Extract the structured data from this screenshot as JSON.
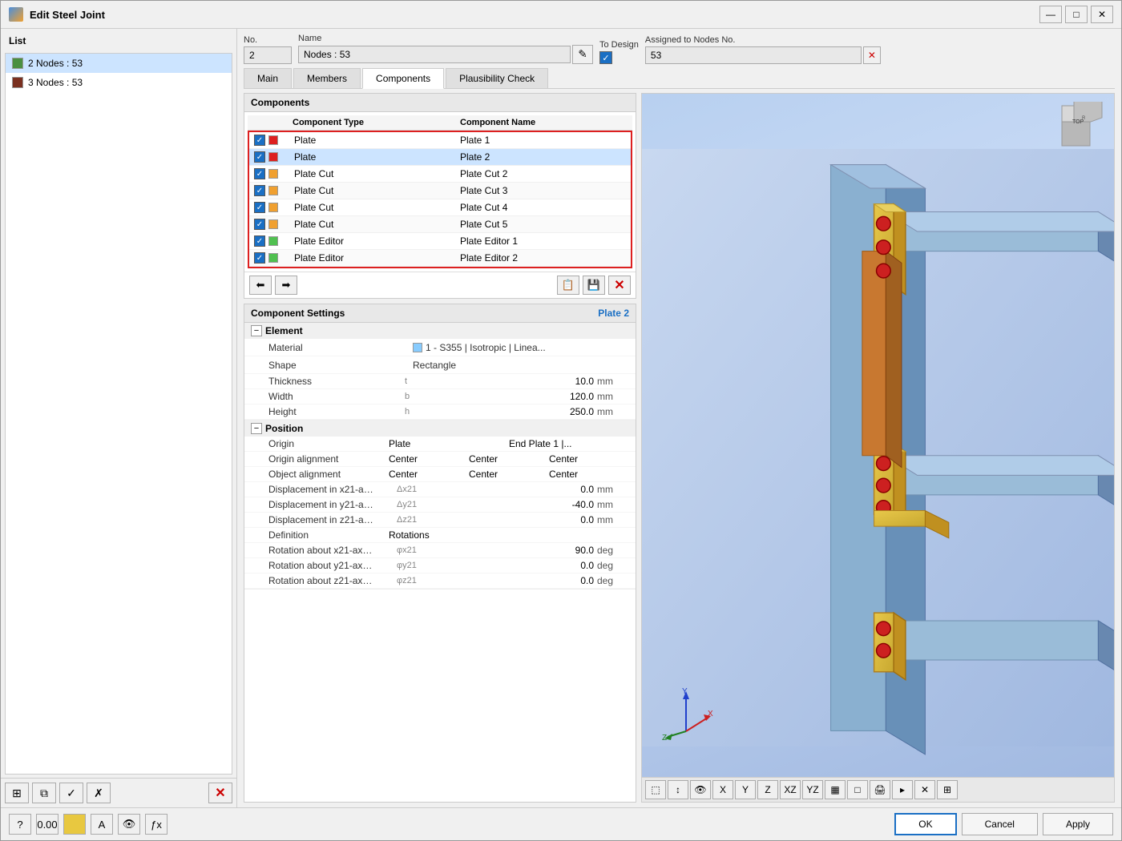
{
  "window": {
    "title": "Edit Steel Joint",
    "minimize_label": "—",
    "maximize_label": "□",
    "close_label": "✕"
  },
  "list": {
    "header": "List",
    "items": [
      {
        "id": 1,
        "label": "2 Nodes : 53",
        "color": "#4a8f40",
        "selected": true
      },
      {
        "id": 2,
        "label": "3 Nodes : 53",
        "color": "#7a3020",
        "selected": false
      }
    ]
  },
  "header": {
    "no_label": "No.",
    "no_value": "2",
    "name_label": "Name",
    "name_value": "Nodes : 53",
    "to_design_label": "To Design",
    "assigned_label": "Assigned to Nodes No.",
    "assigned_value": "53"
  },
  "tabs": [
    {
      "id": "main",
      "label": "Main",
      "active": false
    },
    {
      "id": "members",
      "label": "Members",
      "active": false
    },
    {
      "id": "components",
      "label": "Components",
      "active": true
    },
    {
      "id": "plausibility",
      "label": "Plausibility Check",
      "active": false
    }
  ],
  "components": {
    "section_title": "Components",
    "col_type": "Component Type",
    "col_name": "Component Name",
    "items": [
      {
        "checked": true,
        "color": "red",
        "type": "Plate",
        "name": "Plate 1"
      },
      {
        "checked": true,
        "color": "red",
        "type": "Plate",
        "name": "Plate 2",
        "selected": true
      },
      {
        "checked": true,
        "color": "orange",
        "type": "Plate Cut",
        "name": "Plate Cut 2"
      },
      {
        "checked": true,
        "color": "orange",
        "type": "Plate Cut",
        "name": "Plate Cut 3"
      },
      {
        "checked": true,
        "color": "orange",
        "type": "Plate Cut",
        "name": "Plate Cut 4"
      },
      {
        "checked": true,
        "color": "orange",
        "type": "Plate Cut",
        "name": "Plate Cut 5"
      },
      {
        "checked": true,
        "color": "green",
        "type": "Plate Editor",
        "name": "Plate Editor 1"
      },
      {
        "checked": true,
        "color": "green",
        "type": "Plate Editor",
        "name": "Plate Editor 2"
      }
    ]
  },
  "component_settings": {
    "title": "Component Settings",
    "active_name": "Plate 2",
    "element_group": "Element",
    "properties": {
      "material_label": "Material",
      "material_value": "1 - S355 | Isotropic | Linea...",
      "shape_label": "Shape",
      "shape_value": "Rectangle",
      "thickness_label": "Thickness",
      "thickness_sym": "t",
      "thickness_value": "10.0",
      "thickness_unit": "mm",
      "width_label": "Width",
      "width_sym": "b",
      "width_value": "120.0",
      "width_unit": "mm",
      "height_label": "Height",
      "height_sym": "h",
      "height_value": "250.0",
      "height_unit": "mm"
    },
    "position_group": "Position",
    "position_props": {
      "origin_label": "Origin",
      "origin_val1": "Plate",
      "origin_val2": "End Plate 1 |...",
      "origin_align_label": "Origin alignment",
      "origin_align_val1": "Center",
      "origin_align_val2": "Center",
      "origin_align_val3": "Center",
      "object_align_label": "Object alignment",
      "object_align_val1": "Center",
      "object_align_val2": "Center",
      "object_align_val3": "Center",
      "disp_x_label": "Displacement in x21-a…",
      "disp_x_sym": "Δx21",
      "disp_x_val": "0.0",
      "disp_x_unit": "mm",
      "disp_y_label": "Displacement in y21-a…",
      "disp_y_sym": "Δy21",
      "disp_y_val": "-40.0",
      "disp_y_unit": "mm",
      "disp_z_label": "Displacement in z21-a…",
      "disp_z_sym": "Δz21",
      "disp_z_val": "0.0",
      "disp_z_unit": "mm",
      "definition_label": "Definition",
      "definition_val": "Rotations",
      "rot_x_label": "Rotation about x21-ax…",
      "rot_x_sym": "φx21",
      "rot_x_val": "90.0",
      "rot_x_unit": "deg",
      "rot_y_label": "Rotation about y21-ax…",
      "rot_y_sym": "φy21",
      "rot_y_val": "0.0",
      "rot_y_unit": "deg",
      "rot_z_label": "Rotation about z21-ax…",
      "rot_z_sym": "φz21",
      "rot_z_val": "0.0",
      "rot_z_unit": "deg"
    }
  },
  "buttons": {
    "ok": "OK",
    "cancel": "Cancel",
    "apply": "Apply"
  }
}
